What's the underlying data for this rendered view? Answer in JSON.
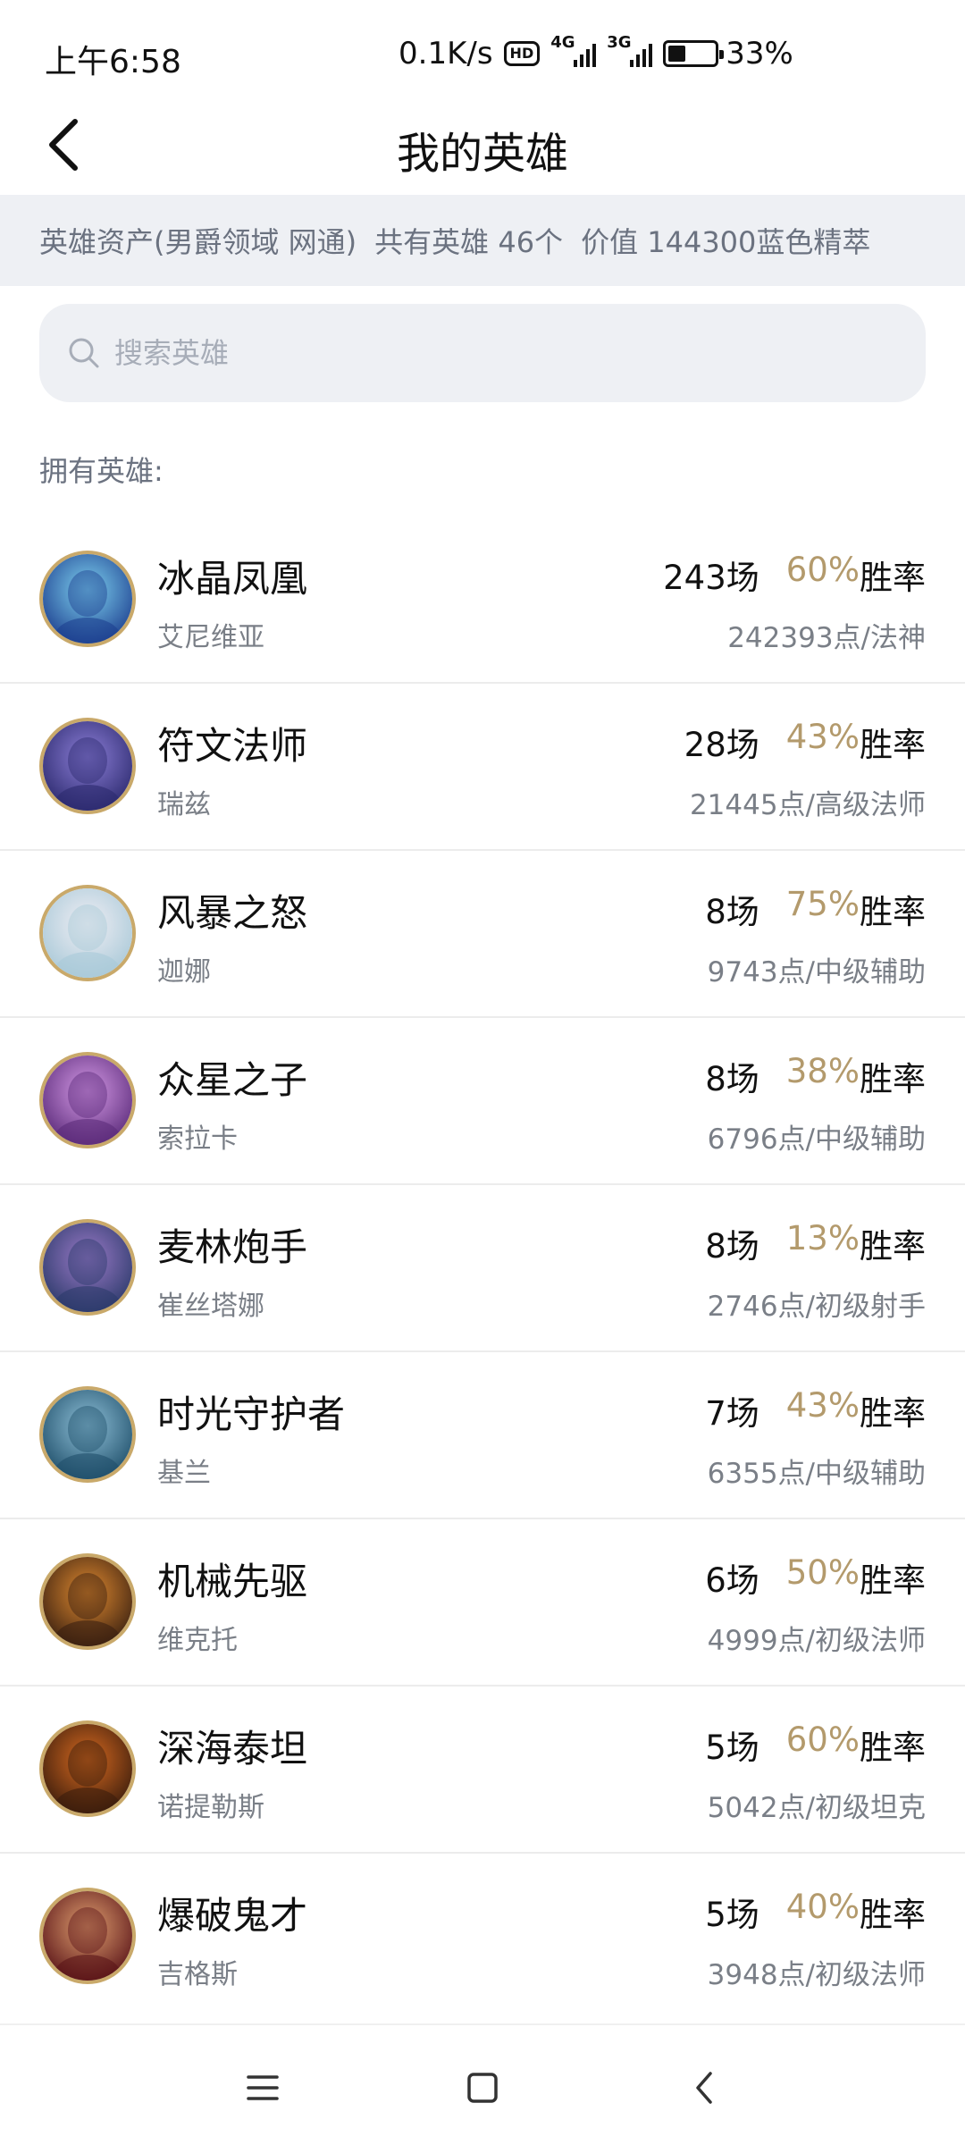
{
  "status_bar": {
    "time": "上午6:58",
    "net_speed": "0.1K/s",
    "hd_badge": "HD",
    "signal_1": "4G",
    "signal_2": "3G",
    "battery_percent": "33%",
    "battery_level": 0.33
  },
  "header": {
    "title": "我的英雄"
  },
  "summary": {
    "assets": "英雄资产(男爵领域 网通)",
    "count": "共有英雄 46个",
    "value": "价值 144300蓝色精萃"
  },
  "search": {
    "placeholder": "搜索英雄"
  },
  "section_label": "拥有英雄:",
  "colors": {
    "winrate": "#b39a6c",
    "avatar_ring": "#c9a96a",
    "strip_bg": "#eef0f4"
  },
  "heroes": [
    {
      "name": "冰晶凤凰",
      "real": "艾尼维亚",
      "games": "243场",
      "winrate": "60%",
      "winrate_suffix": "胜率",
      "points": "242393点/法神",
      "avatar_colors": [
        "#1d3f8f",
        "#7fd3f0"
      ]
    },
    {
      "name": "符文法师",
      "real": "瑞兹",
      "games": "28场",
      "winrate": "43%",
      "winrate_suffix": "胜率",
      "points": "21445点/高级法师",
      "avatar_colors": [
        "#2c2a6e",
        "#8d7fd8"
      ]
    },
    {
      "name": "风暴之怒",
      "real": "迦娜",
      "games": "8场",
      "winrate": "75%",
      "winrate_suffix": "胜率",
      "points": "9743点/中级辅助",
      "avatar_colors": [
        "#a9c9d8",
        "#f0eef4"
      ]
    },
    {
      "name": "众星之子",
      "real": "索拉卡",
      "games": "8场",
      "winrate": "38%",
      "winrate_suffix": "胜率",
      "points": "6796点/中级辅助",
      "avatar_colors": [
        "#5b2b7a",
        "#d59ae6"
      ]
    },
    {
      "name": "麦林炮手",
      "real": "崔丝塔娜",
      "games": "8场",
      "winrate": "13%",
      "winrate_suffix": "胜率",
      "points": "2746点/初级射手",
      "avatar_colors": [
        "#2b3a6a",
        "#9b7ac8"
      ]
    },
    {
      "name": "时光守护者",
      "real": "基兰",
      "games": "7场",
      "winrate": "43%",
      "winrate_suffix": "胜率",
      "points": "6355点/中级辅助",
      "avatar_colors": [
        "#1f4f6a",
        "#8fc0d8"
      ]
    },
    {
      "name": "机械先驱",
      "real": "维克托",
      "games": "6场",
      "winrate": "50%",
      "winrate_suffix": "胜率",
      "points": "4999点/初级法师",
      "avatar_colors": [
        "#3a2010",
        "#e08a30"
      ]
    },
    {
      "name": "深海泰坦",
      "real": "诺提勒斯",
      "games": "5场",
      "winrate": "60%",
      "winrate_suffix": "胜率",
      "points": "5042点/初级坦克",
      "avatar_colors": [
        "#3a1c0c",
        "#d86a20"
      ]
    },
    {
      "name": "爆破鬼才",
      "real": "吉格斯",
      "games": "5场",
      "winrate": "40%",
      "winrate_suffix": "胜率",
      "points": "3948点/初级法师",
      "avatar_colors": [
        "#5a1418",
        "#e0a070"
      ]
    }
  ]
}
